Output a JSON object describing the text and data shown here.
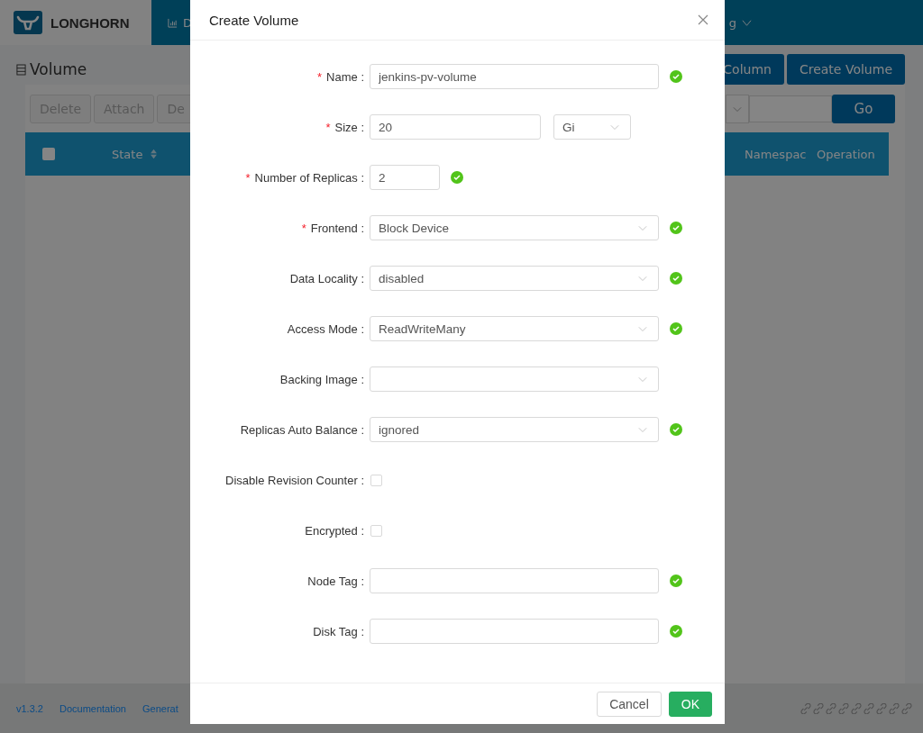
{
  "header": {
    "brand": "LONGHORN",
    "nav": [
      {
        "label": "D",
        "kind": "dashboard"
      },
      {
        "label": "g",
        "kind": "dropdown"
      }
    ]
  },
  "page": {
    "title": "Volume",
    "toolbar": [
      "Delete",
      "Attach",
      "De"
    ],
    "actions": [
      "Column",
      "Create Volume"
    ],
    "go": "Go",
    "select_all_checked": false,
    "columns": [
      {
        "label": "State",
        "sortable": true
      },
      {
        "label": "Namespac"
      },
      {
        "label": "Operation"
      }
    ]
  },
  "footer": {
    "links": [
      "v1.3.2",
      "Documentation",
      "Generat"
    ]
  },
  "modal": {
    "title": "Create Volume",
    "fields": [
      {
        "kind": "text",
        "marker": "*",
        "label": "Name :",
        "value": "jenkins-pv-volume",
        "valid": true
      },
      {
        "kind": "size",
        "marker": "*",
        "label": "Size :",
        "value": "20",
        "unit": "Gi",
        "valid": false
      },
      {
        "kind": "number",
        "marker": "*",
        "label": "Number of Replicas :",
        "value": "2",
        "valid": true
      },
      {
        "kind": "select",
        "marker": "*",
        "label": "Frontend :",
        "value": "Block Device",
        "valid": true
      },
      {
        "kind": "select",
        "label": "Data Locality :",
        "value": "disabled",
        "valid": true
      },
      {
        "kind": "select",
        "label": "Access Mode :",
        "value": "ReadWriteMany",
        "valid": true
      },
      {
        "kind": "select",
        "label": "Backing Image :",
        "valid": false
      },
      {
        "kind": "select",
        "label": "Replicas Auto Balance :",
        "value": "ignored",
        "valid": true
      },
      {
        "kind": "checkbox",
        "label": "Disable Revision Counter :",
        "checked": false,
        "valid": false
      },
      {
        "kind": "checkbox",
        "label": "Encrypted :",
        "checked": false,
        "valid": false
      },
      {
        "kind": "text",
        "label": "Node Tag :",
        "valid": true
      },
      {
        "kind": "text",
        "label": "Disk Tag :",
        "valid": true
      }
    ],
    "buttons": [
      {
        "label": "Cancel",
        "kind": "default"
      },
      {
        "label": "OK",
        "kind": "primary"
      }
    ]
  }
}
